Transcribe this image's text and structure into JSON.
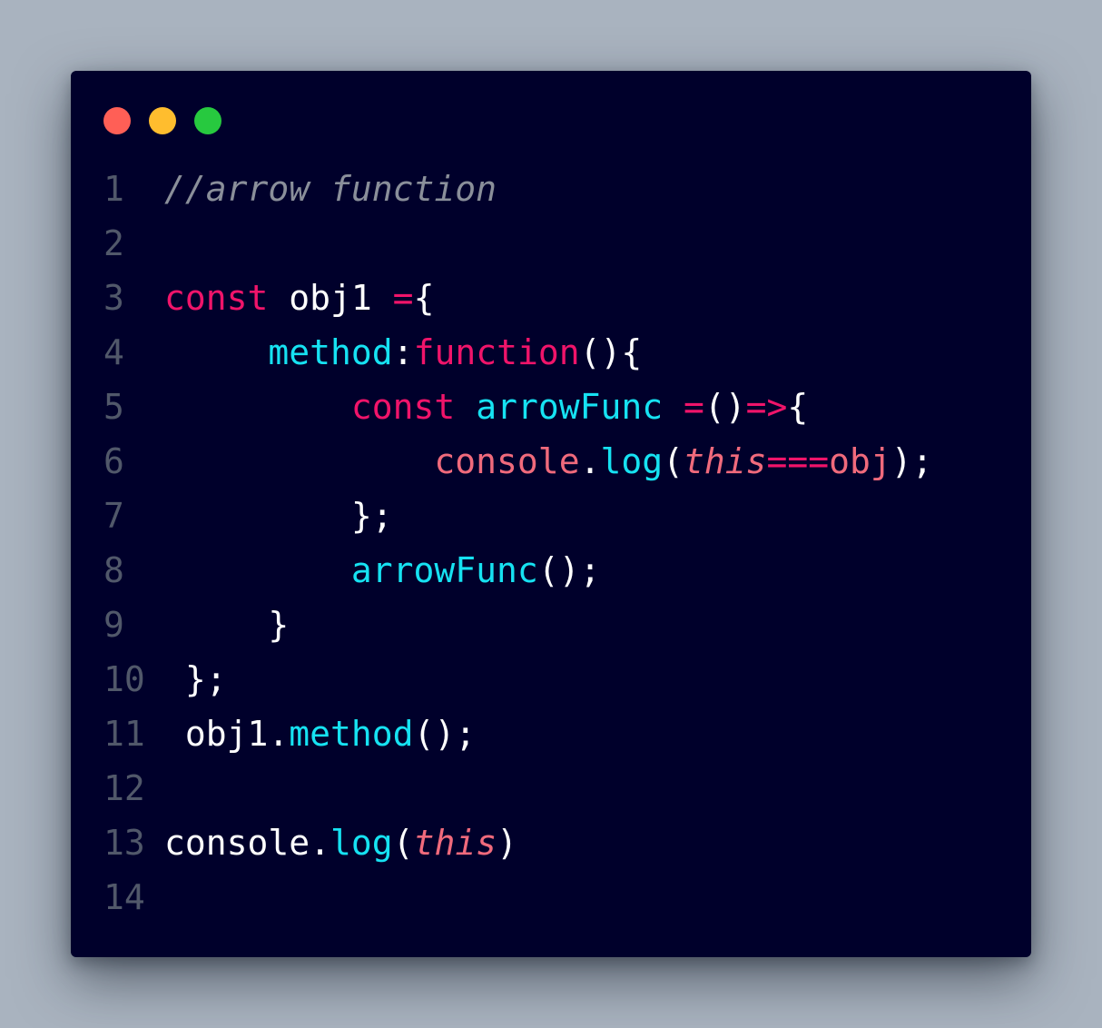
{
  "window": {
    "controls": [
      "close",
      "minimize",
      "maximize"
    ],
    "colors": {
      "close": "#ff5f56",
      "minimize": "#ffbd2e",
      "maximize": "#27c93f",
      "background": "#00002b"
    }
  },
  "editor": {
    "lines": [
      {
        "number": "1",
        "tokens": [
          {
            "t": "//arrow function",
            "c": "cm"
          }
        ]
      },
      {
        "number": "2",
        "tokens": []
      },
      {
        "number": "3",
        "tokens": [
          {
            "t": "const",
            "c": "kw"
          },
          {
            "t": " obj1 ",
            "c": "id"
          },
          {
            "t": "=",
            "c": "op"
          },
          {
            "t": "{",
            "c": "pu"
          }
        ]
      },
      {
        "number": "4",
        "tokens": [
          {
            "t": "     ",
            "c": "id"
          },
          {
            "t": "method",
            "c": "pr"
          },
          {
            "t": ":",
            "c": "pu"
          },
          {
            "t": "function",
            "c": "kw"
          },
          {
            "t": "(){",
            "c": "pu"
          }
        ]
      },
      {
        "number": "5",
        "tokens": [
          {
            "t": "         ",
            "c": "id"
          },
          {
            "t": "const",
            "c": "kw"
          },
          {
            "t": " ",
            "c": "id"
          },
          {
            "t": "arrowFunc",
            "c": "fn"
          },
          {
            "t": " ",
            "c": "id"
          },
          {
            "t": "=",
            "c": "op"
          },
          {
            "t": "()",
            "c": "pu"
          },
          {
            "t": "=>",
            "c": "op"
          },
          {
            "t": "{",
            "c": "pu"
          }
        ]
      },
      {
        "number": "6",
        "tokens": [
          {
            "t": "             ",
            "c": "id"
          },
          {
            "t": "console",
            "c": "ob"
          },
          {
            "t": ".",
            "c": "pu"
          },
          {
            "t": "log",
            "c": "fn"
          },
          {
            "t": "(",
            "c": "pu"
          },
          {
            "t": "this",
            "c": "th"
          },
          {
            "t": "===",
            "c": "op"
          },
          {
            "t": "obj",
            "c": "ob"
          },
          {
            "t": ");",
            "c": "pu"
          }
        ]
      },
      {
        "number": "7",
        "tokens": [
          {
            "t": "         ",
            "c": "id"
          },
          {
            "t": "};",
            "c": "pu"
          }
        ]
      },
      {
        "number": "8",
        "tokens": [
          {
            "t": "         ",
            "c": "id"
          },
          {
            "t": "arrowFunc",
            "c": "fn"
          },
          {
            "t": "();",
            "c": "pu"
          }
        ]
      },
      {
        "number": "9",
        "tokens": [
          {
            "t": "     ",
            "c": "id"
          },
          {
            "t": "}",
            "c": "pu"
          }
        ]
      },
      {
        "number": "10",
        "tokens": [
          {
            "t": " ",
            "c": "id"
          },
          {
            "t": "};",
            "c": "pu"
          }
        ]
      },
      {
        "number": "11",
        "tokens": [
          {
            "t": " obj1",
            "c": "id"
          },
          {
            "t": ".",
            "c": "pu"
          },
          {
            "t": "method",
            "c": "fn"
          },
          {
            "t": "();",
            "c": "pu"
          }
        ]
      },
      {
        "number": "12",
        "tokens": []
      },
      {
        "number": "13",
        "tokens": [
          {
            "t": "console",
            "c": "id"
          },
          {
            "t": ".",
            "c": "pu"
          },
          {
            "t": "log",
            "c": "fn"
          },
          {
            "t": "(",
            "c": "pu"
          },
          {
            "t": "this",
            "c": "th"
          },
          {
            "t": ")",
            "c": "pu"
          }
        ]
      },
      {
        "number": "14",
        "tokens": []
      }
    ]
  }
}
